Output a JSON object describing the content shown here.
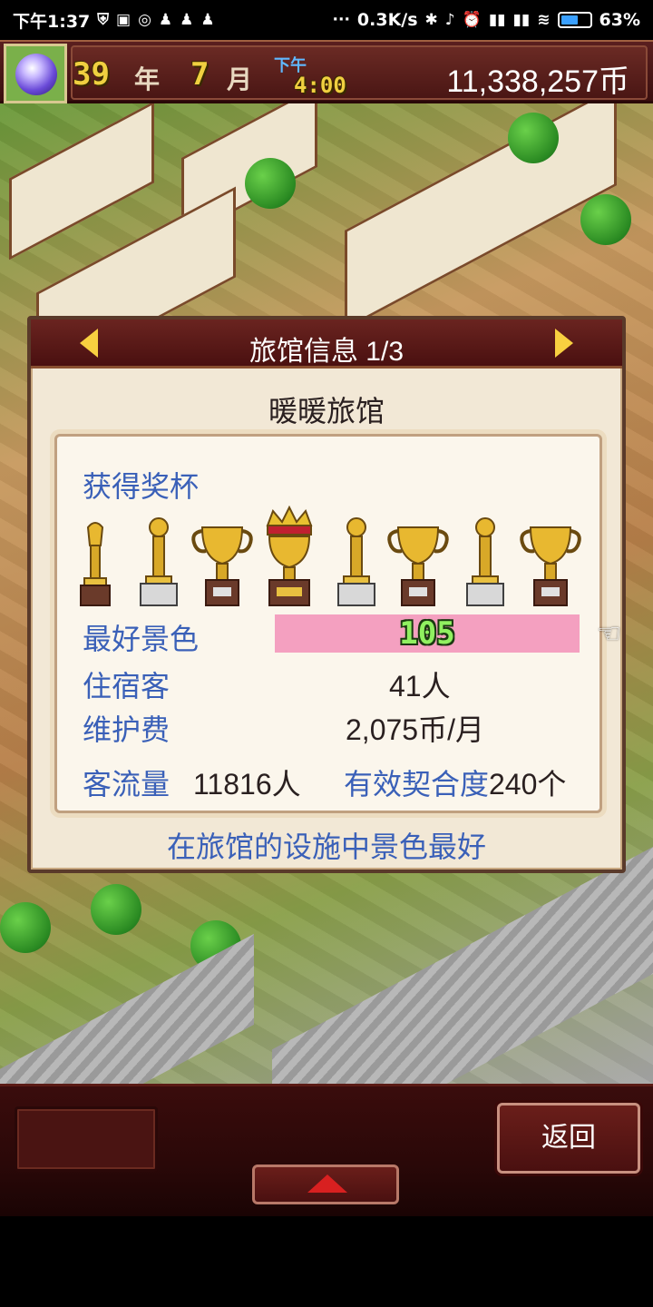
{
  "status_bar": {
    "time": "下午1:37",
    "network_speed": "0.3K/s",
    "battery": "63%",
    "battery_level": 0.63
  },
  "hud": {
    "year": "39",
    "year_unit": "年",
    "month": "7",
    "month_unit": "月",
    "ampm": "下午",
    "clock": "4:00",
    "money": "11,338,257币"
  },
  "dialog": {
    "title": "旅馆信息 1/3",
    "inn_name": "暖暖旅馆",
    "trophies_label": "获得奖杯",
    "trophy_count": 8,
    "stats": {
      "scenery_label": "最好景色",
      "scenery_value": "105",
      "guests_label": "住宿客",
      "guests_value": "41人",
      "upkeep_label": "维护费",
      "upkeep_value": "2,075币/月",
      "traffic_label": "客流量",
      "traffic_value": "11816人",
      "combos_label": "有效契合度",
      "combos_value": "240个"
    },
    "footer_note": "在旅馆的设施中景色最好"
  },
  "bottom": {
    "back_label": "返回"
  }
}
